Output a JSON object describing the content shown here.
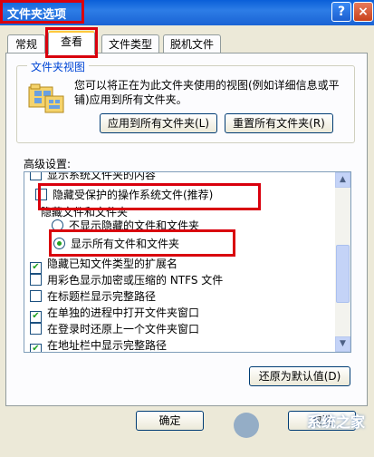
{
  "window": {
    "title": "文件夹选项",
    "help": "?",
    "close": "×"
  },
  "tabs": [
    {
      "label": "常规"
    },
    {
      "label": "查看"
    },
    {
      "label": "文件类型"
    },
    {
      "label": "脱机文件"
    }
  ],
  "folder_views": {
    "group_title": "文件夹视图",
    "description": "您可以将正在为此文件夹使用的视图(例如详细信息或平铺)应用到所有文件夹。",
    "apply_all_button": "应用到所有文件夹(L)",
    "reset_all_button": "重置所有文件夹(R)"
  },
  "advanced": {
    "label": "高级设置:",
    "items": [
      {
        "text": "显示系统文件夹的内容",
        "type": "checkbox",
        "checked": false
      },
      {
        "text": "隐藏受保护的操作系统文件(推荐)",
        "type": "checkbox",
        "checked": false
      },
      {
        "text": "隐藏文件和文件夹",
        "type": "group"
      },
      {
        "text": "不显示隐藏的文件和文件夹",
        "type": "radio",
        "checked": false
      },
      {
        "text": "显示所有文件和文件夹",
        "type": "radio",
        "checked": true
      },
      {
        "text": "隐藏已知文件类型的扩展名",
        "type": "checkbox",
        "checked": true
      },
      {
        "text": "用彩色显示加密或压缩的 NTFS 文件",
        "type": "checkbox",
        "checked": false
      },
      {
        "text": "在标题栏显示完整路径",
        "type": "checkbox",
        "checked": false
      },
      {
        "text": "在单独的进程中打开文件夹窗口",
        "type": "checkbox",
        "checked": true
      },
      {
        "text": "在登录时还原上一个文件夹窗口",
        "type": "checkbox",
        "checked": false
      },
      {
        "text": "在地址栏中显示完整路径",
        "type": "checkbox",
        "checked": true
      }
    ],
    "restore_defaults_button": "还原为默认值(D)"
  },
  "footer": {
    "ok_button": "确定",
    "cancel_button": "取消"
  },
  "watermark": "系统之家",
  "colors": {
    "highlight": "#d9000d",
    "title_bar": "#0a5fd8",
    "check": "#21a121"
  }
}
